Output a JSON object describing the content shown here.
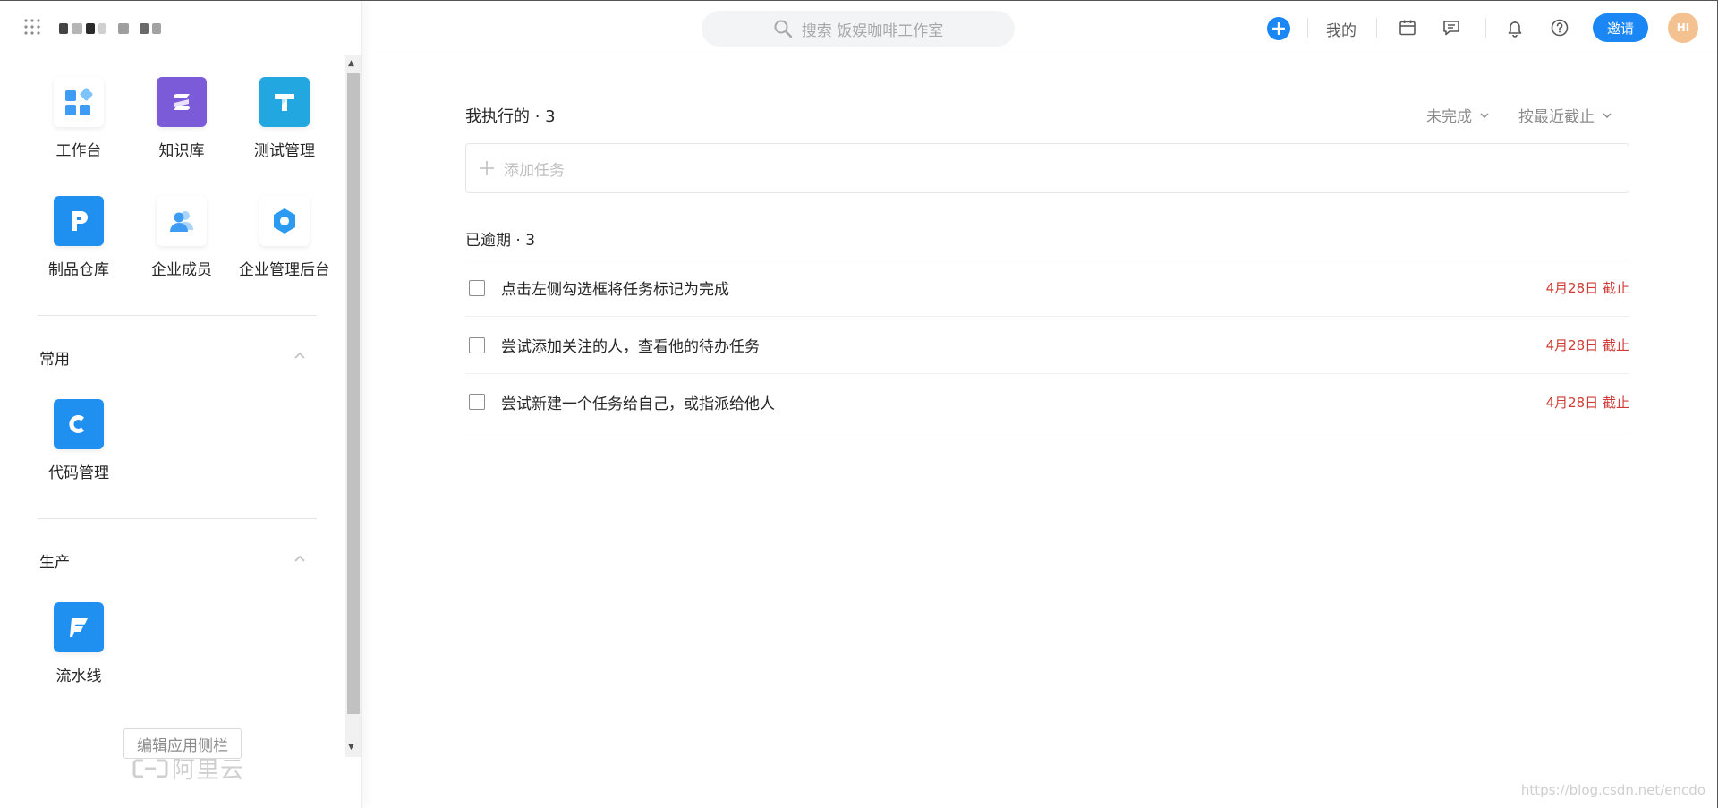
{
  "search": {
    "placeholder": "搜索 饭娱咖啡工作室"
  },
  "topbar": {
    "mine_label": "我的",
    "invite_label": "邀请",
    "avatar_initials": "HI",
    "accent_color": "#1b87f5"
  },
  "sidebar": {
    "apps": [
      {
        "label": "工作台",
        "icon": "workbench-icon"
      },
      {
        "label": "知识库",
        "icon": "knowledge-base-icon"
      },
      {
        "label": "测试管理",
        "icon": "test-management-icon"
      },
      {
        "label": "制品仓库",
        "icon": "artifact-repository-icon"
      },
      {
        "label": "企业成员",
        "icon": "members-icon"
      },
      {
        "label": "企业管理后台",
        "icon": "admin-console-icon"
      }
    ],
    "sections": [
      {
        "title": "常用",
        "apps": [
          {
            "label": "代码管理",
            "icon": "code-management-icon"
          }
        ]
      },
      {
        "title": "生产",
        "apps": [
          {
            "label": "流水线",
            "icon": "pipeline-icon"
          }
        ]
      }
    ],
    "edit_label": "编辑应用侧栏",
    "watermark": "阿里云"
  },
  "main": {
    "title": "我执行的 · 3",
    "filter_status": "未完成",
    "filter_sort": "按最近截止",
    "add_task_placeholder": "添加任务",
    "group_title": "已逾期 · 3",
    "tasks": [
      {
        "text": "点击左侧勾选框将任务标记为完成",
        "due": "4月28日 截止"
      },
      {
        "text": "尝试添加关注的人，查看他的待办任务",
        "due": "4月28日 截止"
      },
      {
        "text": "尝试新建一个任务给自己，或指派给他人",
        "due": "4月28日 截止"
      }
    ],
    "due_color": "#d03b35"
  },
  "watermark": "https://blog.csdn.net/encdo"
}
